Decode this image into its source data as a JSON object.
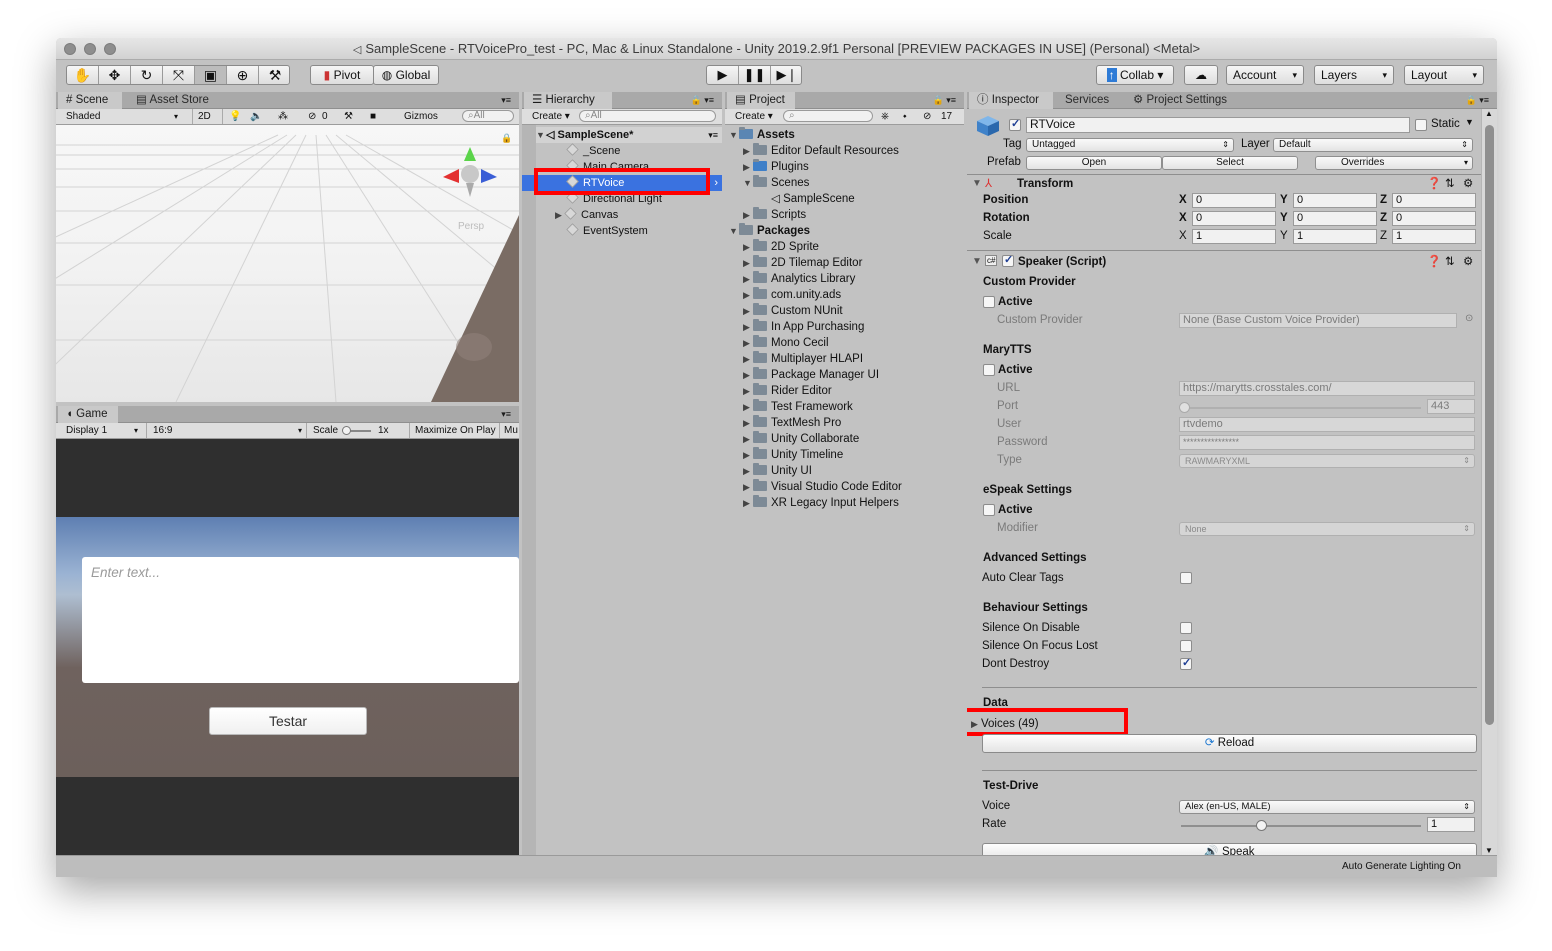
{
  "window": {
    "title": "SampleScene - RTVoicePro_test - PC, Mac & Linux Standalone - Unity 2019.2.9f1 Personal [PREVIEW PACKAGES IN USE] (Personal) <Metal>"
  },
  "toolbar": {
    "pivot": "Pivot",
    "global": "Global",
    "collab": "Collab",
    "account": "Account",
    "layers": "Layers",
    "layout": "Layout"
  },
  "scene": {
    "tab_scene": "Scene",
    "tab_asset_store": "Asset Store",
    "shaded": "Shaded",
    "mode_2d": "2D",
    "hidden_count": "0",
    "gizmos": "Gizmos",
    "search_placeholder": "All",
    "persp": "Persp"
  },
  "game": {
    "tab": "Game",
    "display": "Display 1",
    "aspect": "16:9",
    "scale_label": "Scale",
    "scale_value": "1x",
    "maximize": "Maximize On Play",
    "mute": "Mu",
    "input_placeholder": "Enter text...",
    "button": "Testar"
  },
  "hierarchy": {
    "tab": "Hierarchy",
    "create": "Create",
    "search_placeholder": "All",
    "scene_name": "SampleScene*",
    "items": [
      "_Scene",
      "Main Camera",
      "RTVoice",
      "Directional Light",
      "Canvas",
      "EventSystem"
    ]
  },
  "project": {
    "tab": "Project",
    "create": "Create",
    "hidden_count": "17",
    "assets_label": "Assets",
    "assets": [
      "Editor Default Resources",
      "Plugins",
      "Scenes",
      "SampleScene",
      "Scripts"
    ],
    "packages_label": "Packages",
    "packages": [
      "2D Sprite",
      "2D Tilemap Editor",
      "Analytics Library",
      "com.unity.ads",
      "Custom NUnit",
      "In App Purchasing",
      "Mono Cecil",
      "Multiplayer HLAPI",
      "Package Manager UI",
      "Rider Editor",
      "Test Framework",
      "TextMesh Pro",
      "Unity Collaborate",
      "Unity Timeline",
      "Unity UI",
      "Visual Studio Code Editor",
      "XR Legacy Input Helpers"
    ]
  },
  "inspector": {
    "tabs": [
      "Inspector",
      "Services",
      "Project Settings"
    ],
    "object_name": "RTVoice",
    "static_label": "Static",
    "tag_label": "Tag",
    "tag_value": "Untagged",
    "layer_label": "Layer",
    "layer_value": "Default",
    "prefab_label": "Prefab",
    "prefab_open": "Open",
    "prefab_select": "Select",
    "prefab_overrides": "Overrides",
    "transform": {
      "title": "Transform",
      "position": "Position",
      "rotation": "Rotation",
      "scale": "Scale",
      "axis_x": "X",
      "axis_y": "Y",
      "axis_z": "Z",
      "pos": [
        "0",
        "0",
        "0"
      ],
      "rot": [
        "0",
        "0",
        "0"
      ],
      "scl": [
        "1",
        "1",
        "1"
      ]
    },
    "speaker": {
      "title": "Speaker (Script)",
      "custom_provider_header": "Custom Provider",
      "active": "Active",
      "custom_provider_label": "Custom Provider",
      "custom_provider_value": "None (Base Custom Voice Provider)",
      "marytts_header": "MaryTTS",
      "url_label": "URL",
      "url_value": "https://marytts.crosstales.com/",
      "port_label": "Port",
      "port_value": "443",
      "user_label": "User",
      "user_value": "rtvdemo",
      "password_label": "Password",
      "password_value": "****************",
      "type_label": "Type",
      "type_value": "RAWMARYXML",
      "espeak_header": "eSpeak Settings",
      "modifier_label": "Modifier",
      "modifier_value": "None",
      "advanced_header": "Advanced Settings",
      "auto_clear_tags": "Auto Clear Tags",
      "behaviour_header": "Behaviour Settings",
      "silence_on_disable": "Silence On Disable",
      "silence_on_focus_lost": "Silence On Focus Lost",
      "dont_destroy": "Dont Destroy",
      "data_header": "Data",
      "voices": "Voices (49)",
      "reload": "Reload",
      "test_drive_header": "Test-Drive",
      "voice_label": "Voice",
      "voice_value": "Alex (en-US, MALE)",
      "rate_label": "Rate",
      "rate_value": "1",
      "speak": "Speak"
    }
  },
  "status_bar": "Auto Generate Lighting On",
  "colors": {
    "selection": "#3a72e0",
    "highlight_box": "#ff0000",
    "checkbox_accent": "#1f3f94"
  }
}
